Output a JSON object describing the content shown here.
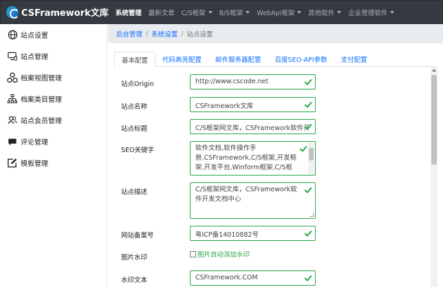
{
  "navbar": {
    "brand": "CSFramework文库",
    "items": [
      {
        "label": "系统管理",
        "active": true,
        "dropdown": false
      },
      {
        "label": "最新文章",
        "active": false,
        "dropdown": false
      },
      {
        "label": "C/S框架",
        "active": false,
        "dropdown": true
      },
      {
        "label": "B/S框架",
        "active": false,
        "dropdown": true
      },
      {
        "label": "WebApi框架",
        "active": false,
        "dropdown": true
      },
      {
        "label": "其他软件",
        "active": false,
        "dropdown": true
      },
      {
        "label": "企业管理软件",
        "active": false,
        "dropdown": true
      }
    ]
  },
  "sidebar": {
    "items": [
      {
        "label": "站点设置",
        "icon": "globe-icon"
      },
      {
        "label": "站点管理",
        "icon": "monitor-icon"
      },
      {
        "label": "档案视图管理",
        "icon": "nodes-icon"
      },
      {
        "label": "档案类目管理",
        "icon": "tree-icon"
      },
      {
        "label": "站点会员管理",
        "icon": "users-icon"
      },
      {
        "label": "评论管理",
        "icon": "comment-icon"
      },
      {
        "label": "模板管理",
        "icon": "edit-icon"
      }
    ]
  },
  "breadcrumb": {
    "home": "后台管理",
    "section": "系统设置",
    "current": "站点设置"
  },
  "tabs": [
    {
      "label": "基本配置",
      "active": true
    },
    {
      "label": "代码高亮配置",
      "active": false
    },
    {
      "label": "邮件服务器配置",
      "active": false
    },
    {
      "label": "百度SEO-API参数",
      "active": false
    },
    {
      "label": "支付配置",
      "active": false
    }
  ],
  "form": {
    "origin": {
      "label": "站点Origin",
      "value": "http://www.cscode.net"
    },
    "name": {
      "label": "站点名称",
      "value": "CSFramework文库"
    },
    "title": {
      "label": "站点标题",
      "value": "C/S框架网文库，CSFramework软件开"
    },
    "keywords": {
      "label": "SEO关键字",
      "value": "软件文档,软件操作手册,CSFramework,C/S框架,开发框架,开发平台,Winform框架,C/S框"
    },
    "description": {
      "label": "站点描述",
      "value": "C/S框架网文库，CSFramework软件开发文档中心"
    },
    "icp": {
      "label": "网站备案号",
      "value": "粤ICP备14010882号"
    },
    "watermark": {
      "label": "图片水印",
      "checkbox_label": "图片自动添加水印",
      "checked": false
    },
    "watermark_text": {
      "label": "水印文本",
      "value": "CSFramework.COM"
    }
  },
  "colors": {
    "navbar_bg": "#343a40",
    "link": "#0d6efd",
    "valid": "#28a745"
  }
}
